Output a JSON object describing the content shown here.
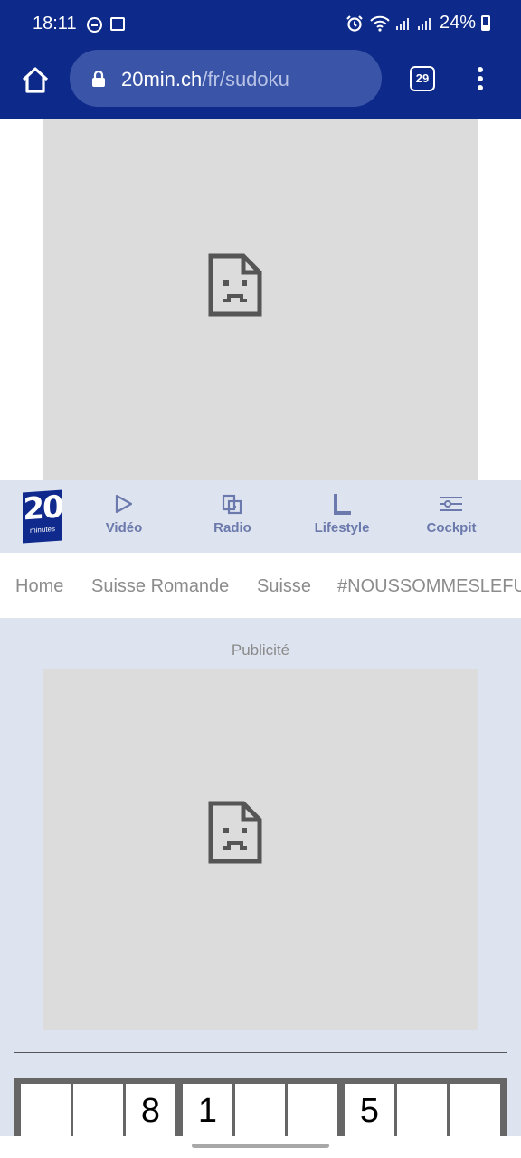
{
  "status_bar": {
    "time": "18:11",
    "battery": "24%"
  },
  "browser": {
    "url_host": "20min.ch",
    "url_path": "/fr/sudoku",
    "tab_count": "29"
  },
  "site_nav": {
    "logo_number": "20",
    "logo_text": "minutes",
    "items": [
      {
        "label": "Vidéo",
        "icon": "play-icon"
      },
      {
        "label": "Radio",
        "icon": "radio-icon"
      },
      {
        "label": "Lifestyle",
        "icon": "lifestyle-icon"
      },
      {
        "label": "Cockpit",
        "icon": "sliders-icon"
      }
    ]
  },
  "menu": [
    "Home",
    "Suisse Romande",
    "Suisse",
    "#NOUSSOMMESLEFUTUR"
  ],
  "ad_label": "Publicité",
  "sudoku_row": [
    "",
    "",
    "8",
    "1",
    "",
    "",
    "5",
    "",
    ""
  ],
  "colors": {
    "browser_bar": "#0d2a8a",
    "nav_bg": "#dde4ef",
    "nav_text": "#6b79ac",
    "ad_placeholder": "#dcdcdc"
  }
}
